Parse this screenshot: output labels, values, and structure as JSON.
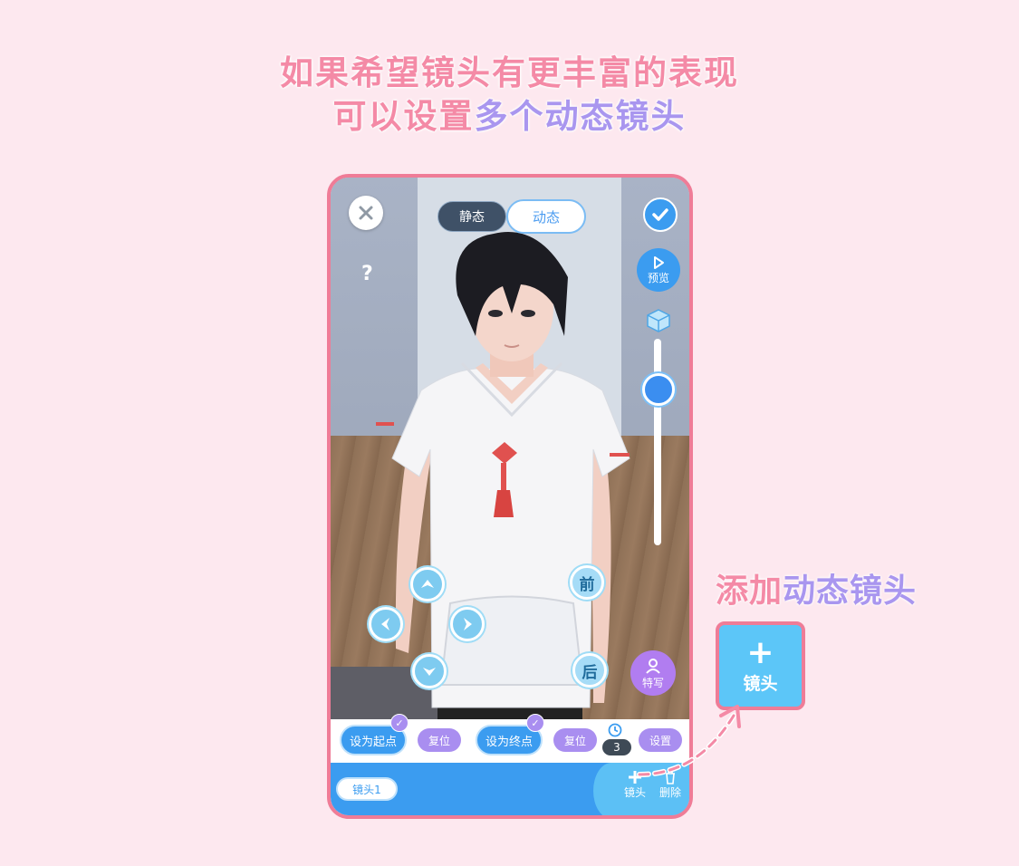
{
  "headline": {
    "line1": "如果希望镜头有更丰富的表现",
    "line2_prefix": "可以设置",
    "line2_accent": "多个动态镜头"
  },
  "top_bar": {
    "close_icon": "close-icon",
    "mode_static": "静态",
    "mode_dynamic": "动态",
    "selected_mode": "动态",
    "confirm_icon": "check-icon"
  },
  "help": {
    "label": "?"
  },
  "right_tools": {
    "preview_label": "预览",
    "height_slider_level": 0.2
  },
  "zoom": {
    "front": "前",
    "back": "后"
  },
  "closeup": {
    "label": "特写"
  },
  "controls": {
    "set_start": "设为起点",
    "reset_start": "复位",
    "set_end": "设为终点",
    "reset_end": "复位",
    "duration": "3",
    "settings": "设置"
  },
  "bottom_bar": {
    "camera_chip": "镜头1",
    "add_camera": "镜头",
    "delete": "删除"
  },
  "annotation": {
    "prefix": "添加",
    "accent": "动态镜头",
    "big_button_label": "镜头",
    "big_button_plus": "+"
  },
  "colors": {
    "pink": "#f48aa6",
    "lavender": "#a996ef",
    "blue": "#3b9cf0",
    "light_blue": "#5cc6f8",
    "purple": "#a98ef0",
    "border_pink": "#ef7c97",
    "background": "#fde8ef"
  }
}
